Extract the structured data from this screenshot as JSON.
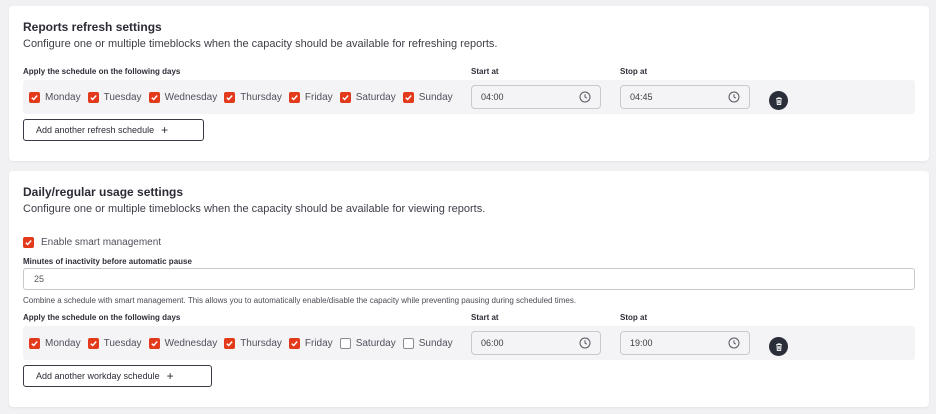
{
  "colors": {
    "accent": "#e23a1b",
    "dark_button": "#2a2e3a",
    "row_background": "#f4f4f6"
  },
  "refresh": {
    "title": "Reports refresh settings",
    "description": "Configure one or multiple timeblocks when the capacity should be available for refreshing reports.",
    "days_label": "Apply the schedule on the following days",
    "start_label": "Start at",
    "stop_label": "Stop at",
    "days": [
      {
        "label": "Monday",
        "checked": true
      },
      {
        "label": "Tuesday",
        "checked": true
      },
      {
        "label": "Wednesday",
        "checked": true
      },
      {
        "label": "Thursday",
        "checked": true
      },
      {
        "label": "Friday",
        "checked": true
      },
      {
        "label": "Saturday",
        "checked": true
      },
      {
        "label": "Sunday",
        "checked": true
      }
    ],
    "start_time": "04:00",
    "stop_time": "04:45",
    "add_button": "Add another refresh schedule",
    "add_icon": "+"
  },
  "daily": {
    "title": "Daily/regular usage settings",
    "description": "Configure one or multiple timeblocks when the capacity should be available for viewing reports.",
    "smart_label": "Enable smart management",
    "smart_checked": true,
    "minutes_label": "Minutes of inactivity before automatic pause",
    "minutes_value": "25",
    "combine_note": "Combine a schedule with smart management. This allows you to automatically enable/disable the capacity while preventing pausing during scheduled times.",
    "days_label": "Apply the schedule on the following days",
    "start_label": "Start at",
    "stop_label": "Stop at",
    "days": [
      {
        "label": "Monday",
        "checked": true
      },
      {
        "label": "Tuesday",
        "checked": true
      },
      {
        "label": "Wednesday",
        "checked": true
      },
      {
        "label": "Thursday",
        "checked": true
      },
      {
        "label": "Friday",
        "checked": true
      },
      {
        "label": "Saturday",
        "checked": false
      },
      {
        "label": "Sunday",
        "checked": false
      }
    ],
    "start_time": "06:00",
    "stop_time": "19:00",
    "add_button": "Add another workday schedule",
    "add_icon": "+"
  },
  "icons": {
    "checkbox": "check-icon",
    "time": "clock-icon",
    "delete": "trash-icon"
  }
}
